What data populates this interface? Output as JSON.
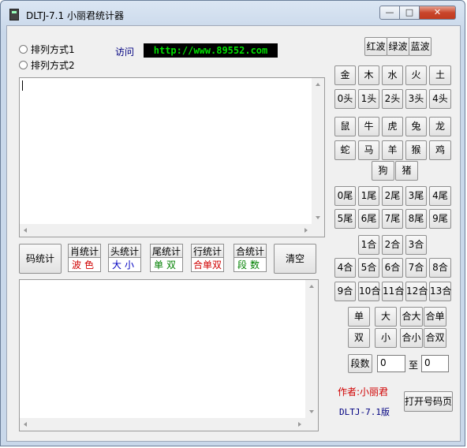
{
  "window": {
    "title": "DLTJ-7.1 小丽君统计器",
    "controls": {
      "minimize": "—",
      "maximize": "□",
      "close": "✕"
    }
  },
  "options": [
    "排列方式1",
    "排列方式2"
  ],
  "visit": {
    "label": "访问",
    "url": "http://www.89552.com"
  },
  "color_buttons": [
    "红波",
    "绿波",
    "蓝波"
  ],
  "zodiac_elements": [
    "金",
    "木",
    "水",
    "火",
    "土"
  ],
  "heads": [
    "0头",
    "1头",
    "2头",
    "3头",
    "4头"
  ],
  "animals_row1": [
    "鼠",
    "牛",
    "虎",
    "兔",
    "龙"
  ],
  "animals_row2": [
    "蛇",
    "马",
    "羊",
    "猴",
    "鸡"
  ],
  "animals_row3": [
    "狗",
    "猪"
  ],
  "tails_row1": [
    "0尾",
    "1尾",
    "2尾",
    "3尾",
    "4尾"
  ],
  "tails_row2": [
    "5尾",
    "6尾",
    "7尾",
    "8尾",
    "9尾"
  ],
  "sums_row1": [
    "1合",
    "2合",
    "3合"
  ],
  "sums_row2": [
    "4合",
    "5合",
    "6合",
    "7合",
    "8合"
  ],
  "sums_row3": [
    "9合",
    "10合",
    "11合",
    "12合",
    "13合"
  ],
  "parity_row1": [
    "单",
    "大",
    "合大",
    "合单"
  ],
  "parity_row2": [
    "双",
    "小",
    "合小",
    "合双"
  ],
  "segment": {
    "label": "段数",
    "from": "0",
    "to_label": "至",
    "to": "0"
  },
  "stats": {
    "code": "码统计",
    "zodiac": {
      "top": "肖统计",
      "bottom": "波色"
    },
    "head": {
      "top": "头统计",
      "bottom": "大小"
    },
    "tail": {
      "top": "尾统计",
      "bottom": "单双"
    },
    "row": {
      "top": "行统计",
      "bottom": "合单双"
    },
    "sum": {
      "top": "合统计",
      "bottom": "段数"
    },
    "clear": "清空"
  },
  "author": "作者:小丽君",
  "version": "DLTJ-7.1版",
  "open_page": "打开号码页",
  "colors": {
    "url_bg": "#000000",
    "url_text": "#00e000",
    "red": "#d00000",
    "blue": "#0000c0",
    "green": "#008000",
    "navy": "#000080"
  }
}
